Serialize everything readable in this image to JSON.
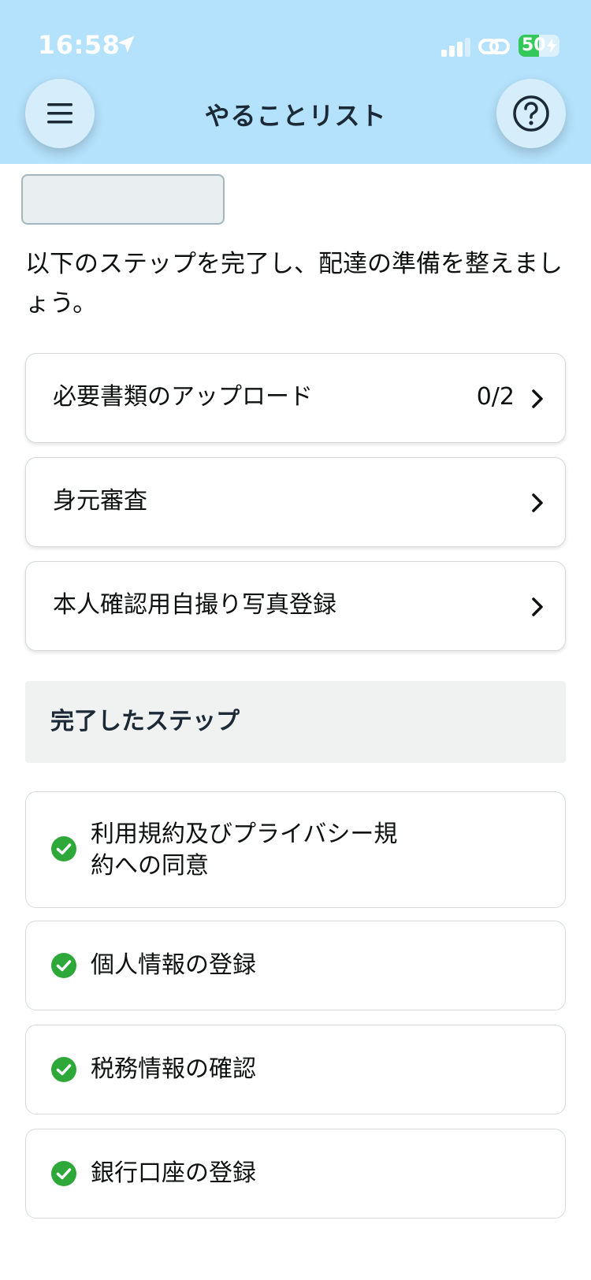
{
  "status_bar": {
    "time": "16:58",
    "battery_percent": "50",
    "battery_level": 0.5
  },
  "header": {
    "title": "やることリスト",
    "menu_icon": "hamburger-menu-icon",
    "help_icon": "question-circle-icon",
    "background_color": "#b4e1fb"
  },
  "intro_text": "以下のステップを完了し、配達の準備を整えましょう。",
  "pending_steps": [
    {
      "label": "必要書類のアップロード",
      "count": "0/2"
    },
    {
      "label": "身元審査",
      "count": ""
    },
    {
      "label": "本人確認用自撮り写真登録",
      "count": ""
    }
  ],
  "completed_section": {
    "title": "完了したステップ",
    "items": [
      {
        "label_line1": "利用規約及びプライバシー規",
        "label_line2": "約への同意"
      },
      {
        "label_line1": "個人情報の登録"
      },
      {
        "label_line1": "税務情報の確認"
      },
      {
        "label_line1": "銀行口座の登録"
      }
    ],
    "check_color": "#2fa83a"
  }
}
